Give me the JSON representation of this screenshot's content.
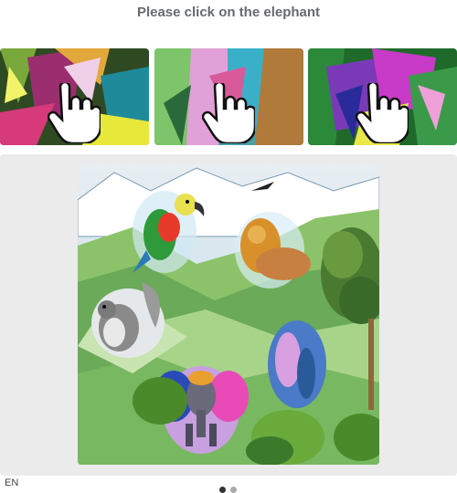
{
  "challenge": {
    "prompt": "Please click on the elephant"
  },
  "examples": [
    {
      "icon": "pointing-hand-icon",
      "subject": "elephant"
    },
    {
      "icon": "pointing-hand-icon",
      "subject": "elephant"
    },
    {
      "icon": "pointing-hand-icon",
      "subject": "elephant"
    }
  ],
  "footer": {
    "language": "EN"
  },
  "colors": {
    "prompt": "#666a6e",
    "panel": "#ebebeb"
  }
}
